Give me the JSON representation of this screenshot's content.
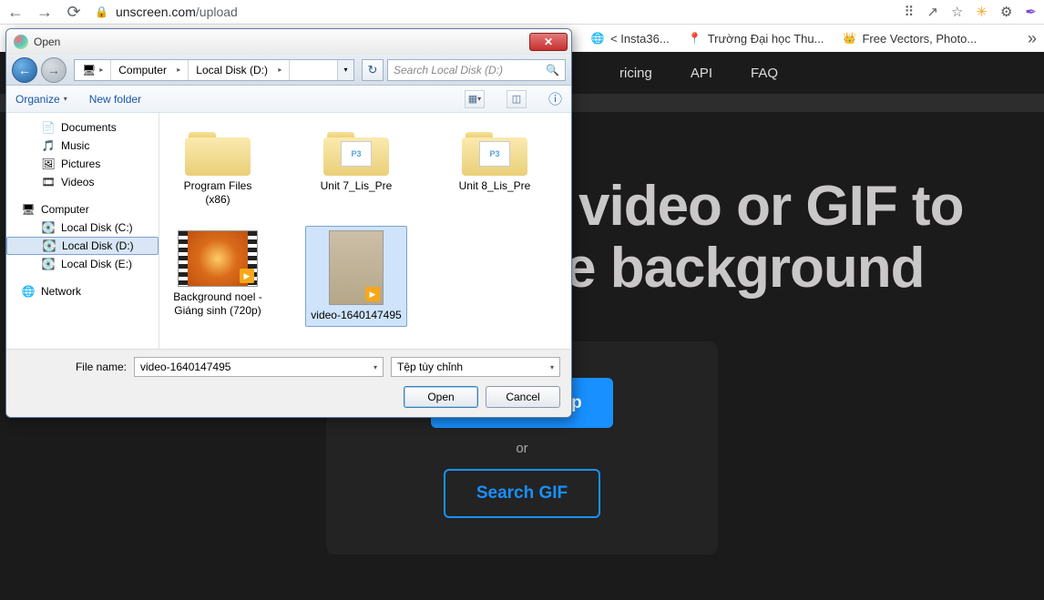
{
  "browser": {
    "url_host": "unscreen.com",
    "url_path": "/upload"
  },
  "bookmarks": {
    "b1": "< Insta36...",
    "b2": "Trường Đại học Thu...",
    "b3": "Free Vectors, Photo..."
  },
  "site": {
    "nav": {
      "pricing": "ricing",
      "api": "API",
      "faq": "FAQ"
    },
    "hero_line1": "video or GIF to",
    "hero_line2": "e background",
    "btn_upload": "Upload Clip",
    "or": "or",
    "btn_search": "Search GIF"
  },
  "dialog": {
    "title": "Open",
    "path": {
      "seg1": "Computer",
      "seg2": "Local Disk (D:)"
    },
    "search_placeholder": "Search Local Disk (D:)",
    "toolbar": {
      "organize": "Organize",
      "newfolder": "New folder"
    },
    "tree": {
      "documents": "Documents",
      "music": "Music",
      "pictures": "Pictures",
      "videos": "Videos",
      "computer": "Computer",
      "disk_c": "Local Disk (C:)",
      "disk_d": "Local Disk (D:)",
      "disk_e": "Local Disk (E:)",
      "network": "Network"
    },
    "files": {
      "f1": "Program Files (x86)",
      "f2": "Unit 7_Lis_Pre",
      "f3": "Unit 8_Lis_Pre",
      "f4": "Background noel - Giáng sinh (720p)",
      "f5": "video-1640147495",
      "mp3": "P3"
    },
    "filename_label": "File name:",
    "filename_value": "video-1640147495",
    "filetype": "Tệp tùy chỉnh",
    "btn_open": "Open",
    "btn_cancel": "Cancel"
  }
}
